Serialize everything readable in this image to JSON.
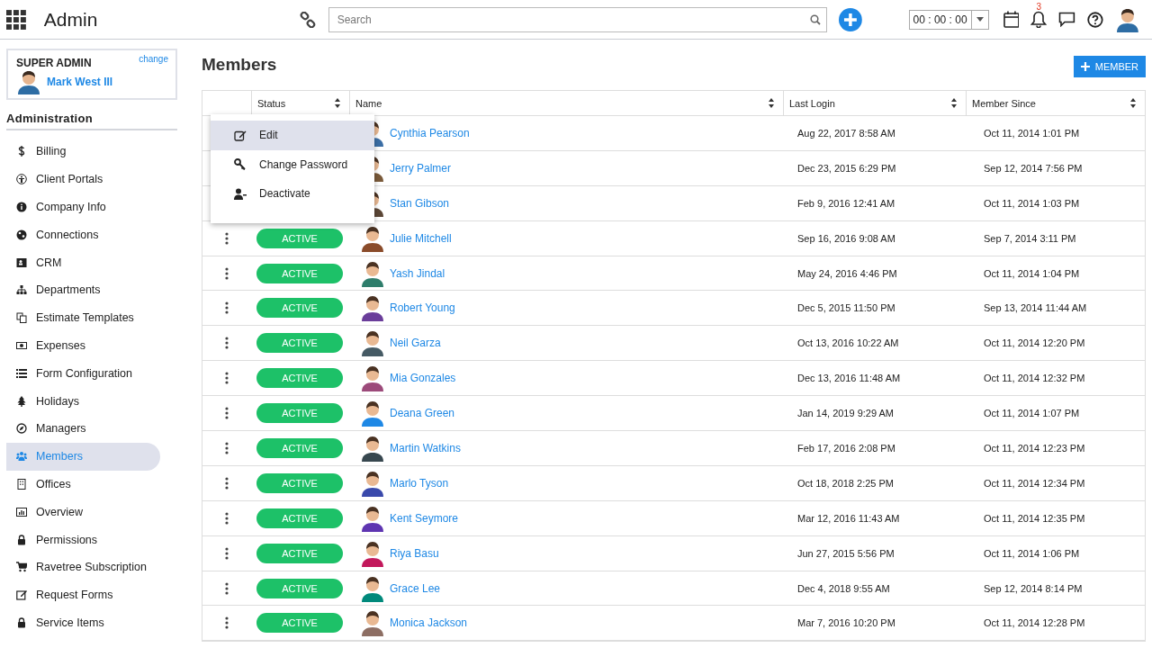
{
  "header": {
    "title": "Admin",
    "search": {
      "placeholder": "Search"
    },
    "timer": "00 : 00 : 00",
    "notifications": "3"
  },
  "account": {
    "role": "SUPER ADMIN",
    "change": "change",
    "name": "Mark West III"
  },
  "sidebar": {
    "heading": "Administration",
    "items": [
      {
        "label": "Billing",
        "selected": false
      },
      {
        "label": "Client Portals",
        "selected": false
      },
      {
        "label": "Company Info",
        "selected": false
      },
      {
        "label": "Connections",
        "selected": false
      },
      {
        "label": "CRM",
        "selected": false
      },
      {
        "label": "Departments",
        "selected": false
      },
      {
        "label": "Estimate Templates",
        "selected": false
      },
      {
        "label": "Expenses",
        "selected": false
      },
      {
        "label": "Form Configuration",
        "selected": false
      },
      {
        "label": "Holidays",
        "selected": false
      },
      {
        "label": "Managers",
        "selected": false
      },
      {
        "label": "Members",
        "selected": true
      },
      {
        "label": "Offices",
        "selected": false
      },
      {
        "label": "Overview",
        "selected": false
      },
      {
        "label": "Permissions",
        "selected": false
      },
      {
        "label": "Ravetree Subscription",
        "selected": false
      },
      {
        "label": "Request Forms",
        "selected": false
      },
      {
        "label": "Service Items",
        "selected": false
      }
    ]
  },
  "page": {
    "title": "Members",
    "add_button": "MEMBER"
  },
  "table": {
    "columns": [
      "Status",
      "Name",
      "Last Login",
      "Member Since"
    ],
    "rows": [
      {
        "name": "Cynthia Pearson",
        "last_login": "Aug 22, 2017 8:58 AM",
        "member_since": "Oct 11, 2014 1:01 PM"
      },
      {
        "name": "Jerry Palmer",
        "last_login": "Dec 23, 2015 6:29 PM",
        "member_since": "Sep 12, 2014 7:56 PM"
      },
      {
        "name": "Stan Gibson",
        "last_login": "Feb 9, 2016 12:41 AM",
        "member_since": "Oct 11, 2014 1:03 PM"
      },
      {
        "status": "ACTIVE",
        "name": "Julie Mitchell",
        "last_login": "Sep 16, 2016 9:08 AM",
        "member_since": "Sep 7, 2014 3:11 PM"
      },
      {
        "status": "ACTIVE",
        "name": "Yash Jindal",
        "last_login": "May 24, 2016 4:46 PM",
        "member_since": "Oct 11, 2014 1:04 PM"
      },
      {
        "status": "ACTIVE",
        "name": "Robert Young",
        "last_login": "Dec 5, 2015 11:50 PM",
        "member_since": "Sep 13, 2014 11:44 AM"
      },
      {
        "status": "ACTIVE",
        "name": "Neil Garza",
        "last_login": "Oct 13, 2016 10:22 AM",
        "member_since": "Oct 11, 2014 12:20 PM"
      },
      {
        "status": "ACTIVE",
        "name": "Mia Gonzales",
        "last_login": "Dec 13, 2016 11:48 AM",
        "member_since": "Oct 11, 2014 12:32 PM"
      },
      {
        "status": "ACTIVE",
        "name": "Deana Green",
        "last_login": "Jan 14, 2019 9:29 AM",
        "member_since": "Oct 11, 2014 1:07 PM"
      },
      {
        "status": "ACTIVE",
        "name": "Martin Watkins",
        "last_login": "Feb 17, 2016 2:08 PM",
        "member_since": "Oct 11, 2014 12:23 PM"
      },
      {
        "status": "ACTIVE",
        "name": "Marlo Tyson",
        "last_login": "Oct 18, 2018 2:25 PM",
        "member_since": "Oct 11, 2014 12:34 PM"
      },
      {
        "status": "ACTIVE",
        "name": "Kent Seymore",
        "last_login": "Mar 12, 2016 11:43 AM",
        "member_since": "Oct 11, 2014 12:35 PM"
      },
      {
        "status": "ACTIVE",
        "name": "Riya Basu",
        "last_login": "Jun 27, 2015 5:56 PM",
        "member_since": "Oct 11, 2014 1:06 PM"
      },
      {
        "status": "ACTIVE",
        "name": "Grace Lee",
        "last_login": "Dec 4, 2018 9:55 AM",
        "member_since": "Sep 12, 2014 8:14 PM"
      },
      {
        "status": "ACTIVE",
        "name": "Monica Jackson",
        "last_login": "Mar 7, 2016 10:20 PM",
        "member_since": "Oct 11, 2014 12:28 PM"
      }
    ]
  },
  "row_menu": {
    "items": [
      {
        "label": "Edit",
        "selected": true
      },
      {
        "label": "Change Password",
        "selected": false
      },
      {
        "label": "Deactivate",
        "selected": false
      }
    ]
  }
}
